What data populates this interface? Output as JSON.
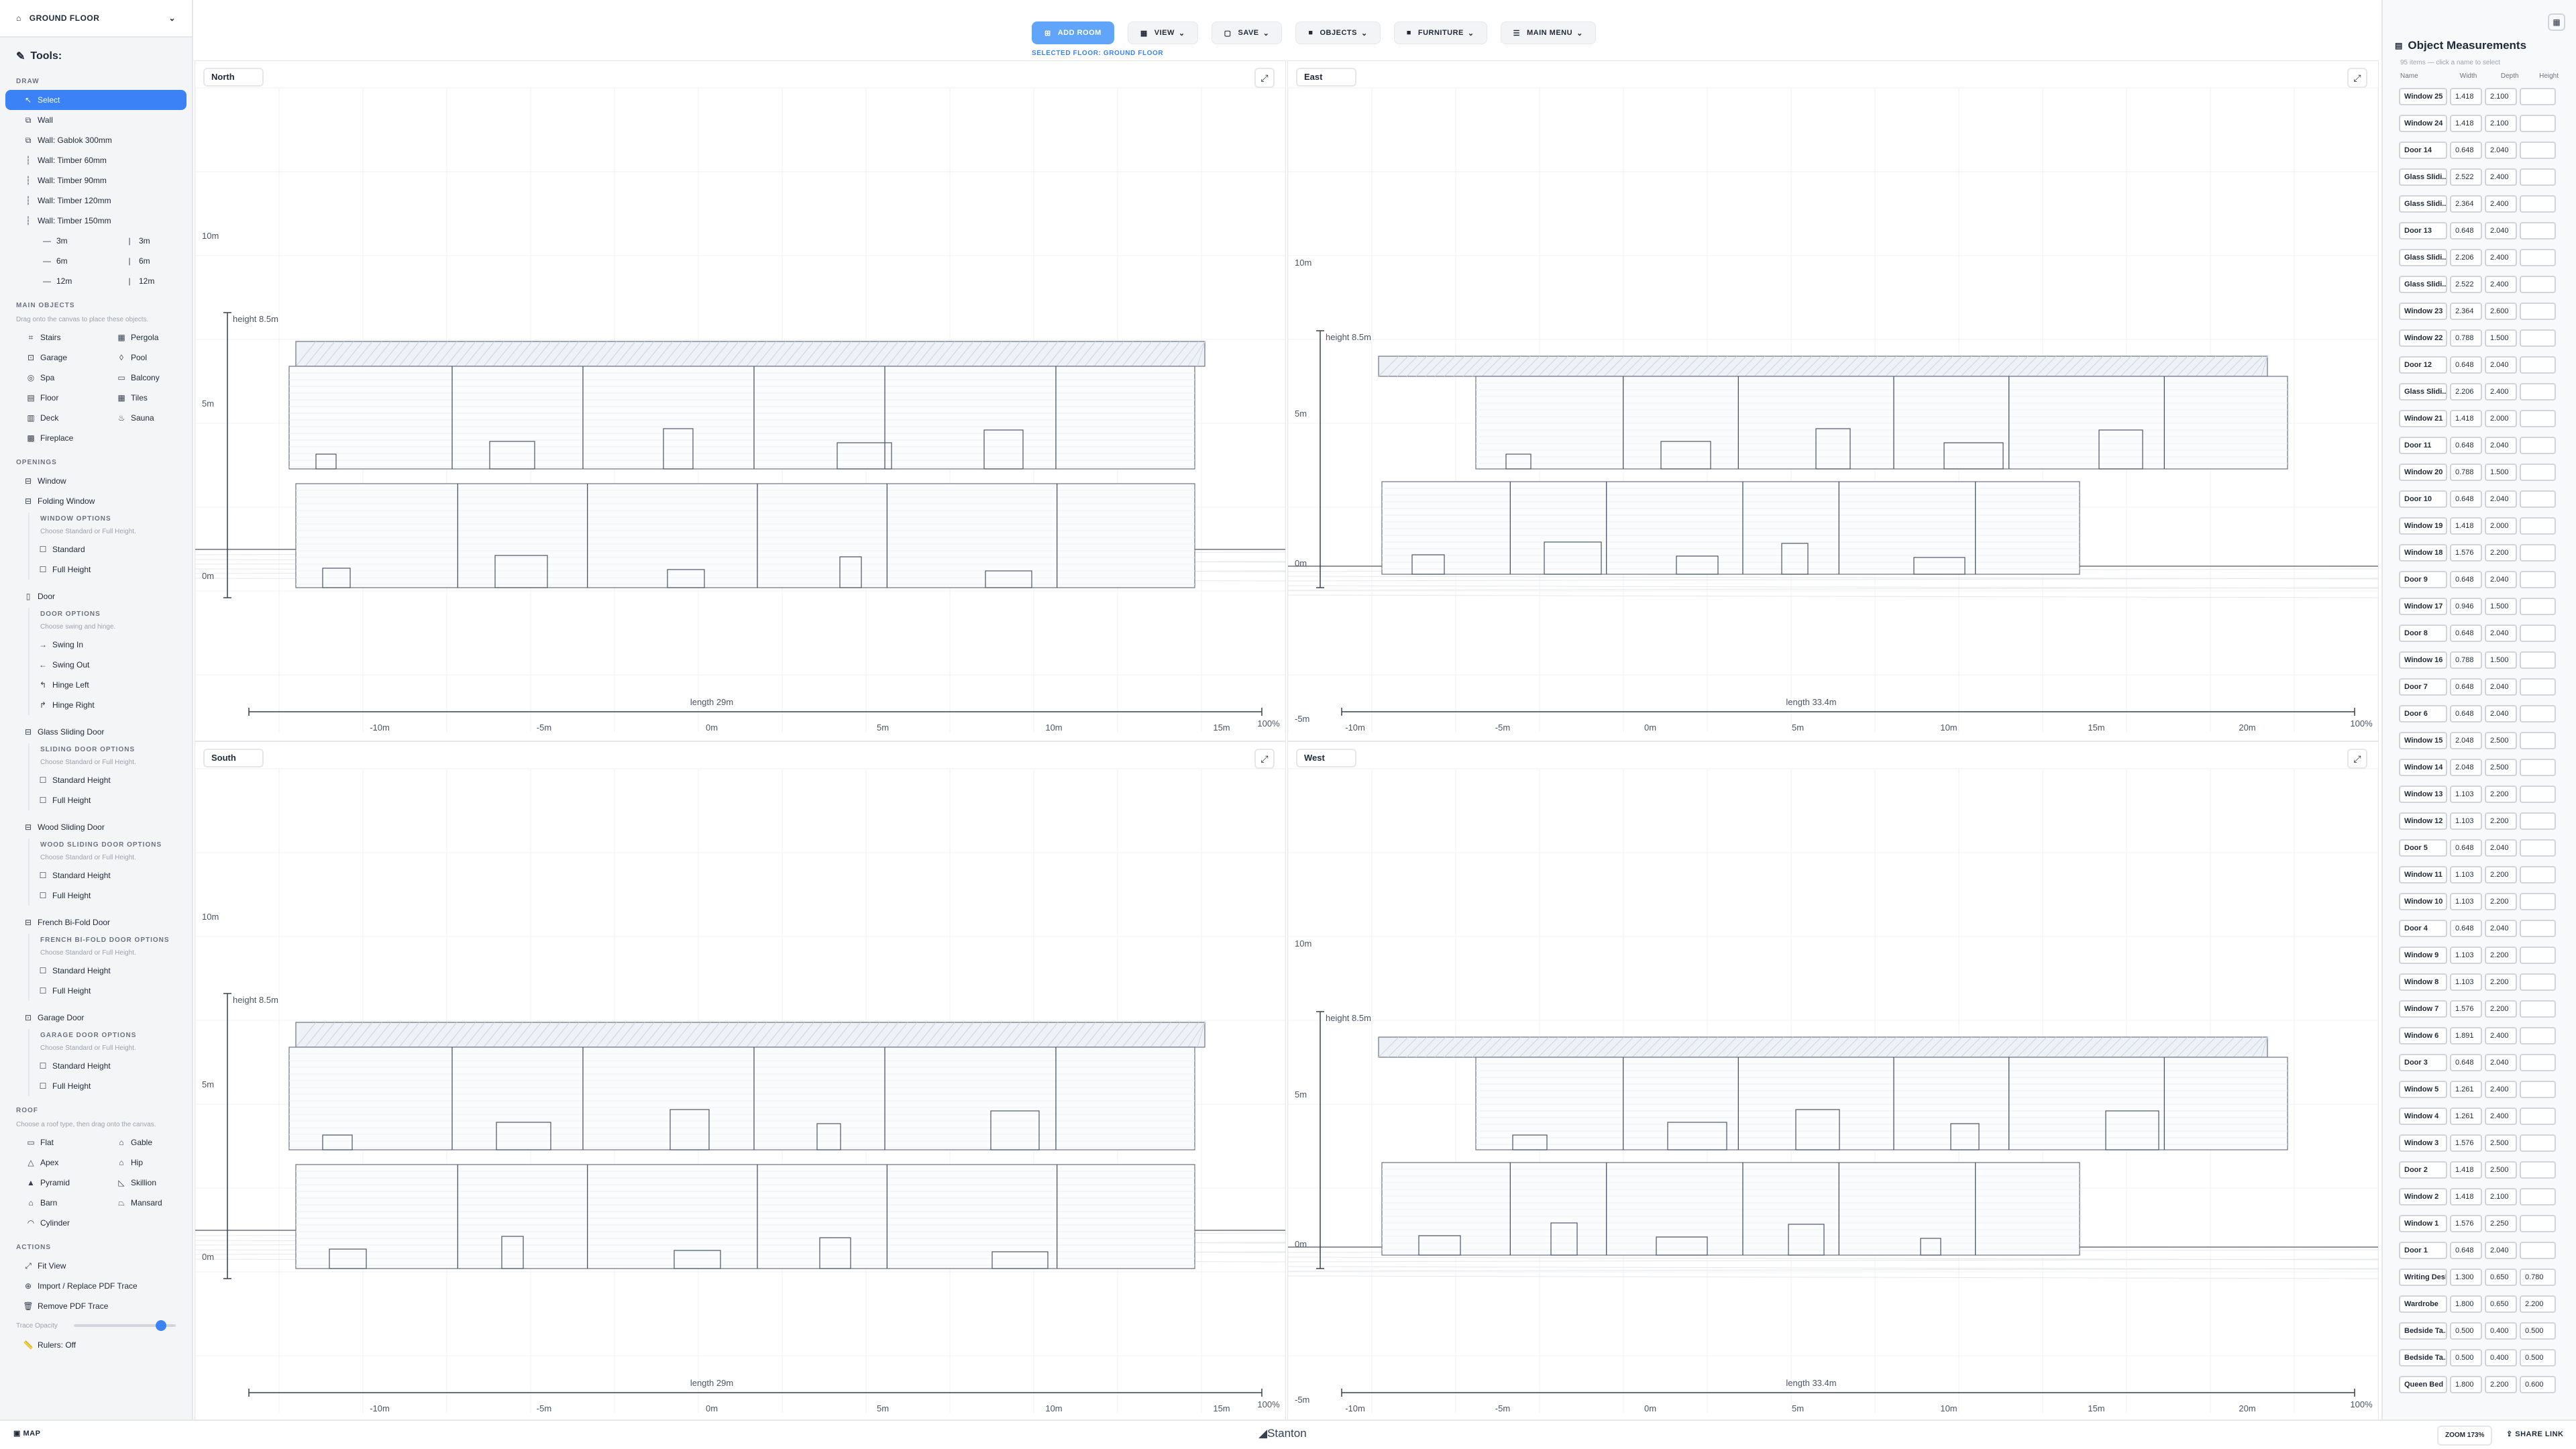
{
  "floor_selector": {
    "label": "GROUND FLOOR"
  },
  "tools": {
    "title": "Tools:"
  },
  "draw": {
    "section": "DRAW",
    "items": [
      "Select",
      "Wall",
      "Wall: Gablok 300mm",
      "Wall: Timber 60mm",
      "Wall: Timber 90mm",
      "Wall: Timber 120mm",
      "Wall: Timber 150mm"
    ],
    "lengths_left": [
      "3m",
      "6m",
      "12m"
    ],
    "lengths_right": [
      "3m",
      "6m",
      "12m"
    ]
  },
  "main_objects": {
    "section": "MAIN OBJECTS",
    "hint": "Drag onto the canvas to place these objects.",
    "left": [
      "Stairs",
      "Garage",
      "Spa",
      "Floor",
      "Deck",
      "Fireplace"
    ],
    "right": [
      "Pergola",
      "Pool",
      "Balcony",
      "Tiles",
      "Sauna"
    ]
  },
  "openings": {
    "section": "OPENINGS",
    "window": "Window",
    "folding_window": "Folding Window",
    "window_options": {
      "title": "WINDOW OPTIONS",
      "hint": "Choose Standard or Full Height.",
      "items": [
        "Standard",
        "Full Height"
      ]
    },
    "door": "Door",
    "door_options": {
      "title": "DOOR OPTIONS",
      "hint": "Choose swing and hinge.",
      "items": [
        "Swing In",
        "Swing Out",
        "Hinge Left",
        "Hinge Right"
      ]
    },
    "glass_sliding": "Glass Sliding Door",
    "glass_options": {
      "title": "SLIDING DOOR OPTIONS",
      "hint": "Choose Standard or Full Height.",
      "items": [
        "Standard Height",
        "Full Height"
      ]
    },
    "wood_sliding": "Wood Sliding Door",
    "wood_options": {
      "title": "WOOD SLIDING DOOR OPTIONS",
      "hint": "Choose Standard or Full Height.",
      "items": [
        "Standard Height",
        "Full Height"
      ]
    },
    "french": "French Bi-Fold Door",
    "french_options": {
      "title": "FRENCH BI-FOLD DOOR OPTIONS",
      "hint": "Choose Standard or Full Height.",
      "items": [
        "Standard Height",
        "Full Height"
      ]
    },
    "garage": "Garage Door",
    "garage_options": {
      "title": "GARAGE DOOR OPTIONS",
      "hint": "Choose Standard or Full Height.",
      "items": [
        "Standard Height",
        "Full Height"
      ]
    }
  },
  "roof": {
    "section": "ROOF",
    "hint": "Choose a roof type, then drag onto the canvas.",
    "left": [
      "Flat",
      "Apex",
      "Pyramid",
      "Barn",
      "Cylinder"
    ],
    "right": [
      "Gable",
      "Hip",
      "Skillion",
      "Mansard"
    ]
  },
  "actions": {
    "section": "ACTIONS",
    "items": [
      "Fit View",
      "Import / Replace PDF Trace",
      "Remove PDF Trace"
    ],
    "trace_opacity": "Trace Opacity",
    "trace_value": 0.85,
    "rulers": "Rulers: Off"
  },
  "toolbar": {
    "add_room": "ADD ROOM",
    "view": "VIEW",
    "save": "SAVE",
    "objects": "OBJECTS",
    "furniture": "FURNITURE",
    "main_menu": "MAIN MENU",
    "selected_floor": "SELECTED FLOOR: GROUND FLOOR"
  },
  "elevations": [
    {
      "title": "North",
      "height_label": "height 8.5m",
      "length_label": "length 29m",
      "zoom": "100%",
      "y_ticks": [
        "10m",
        "5m",
        "0m"
      ],
      "x_ticks": [
        "-10m",
        "-5m",
        "0m",
        "5m",
        "10m",
        "15m"
      ]
    },
    {
      "title": "East",
      "height_label": "height 8.5m",
      "length_label": "length 33.4m",
      "zoom": "100%",
      "y_ticks": [
        "10m",
        "5m",
        "0m",
        "-5m"
      ],
      "x_ticks": [
        "-10m",
        "-5m",
        "0m",
        "5m",
        "10m",
        "15m",
        "20m"
      ]
    },
    {
      "title": "South",
      "height_label": "height 8.5m",
      "length_label": "length 29m",
      "zoom": "100%",
      "y_ticks": [
        "10m",
        "5m",
        "0m"
      ],
      "x_ticks": [
        "-10m",
        "-5m",
        "0m",
        "5m",
        "10m",
        "15m"
      ]
    },
    {
      "title": "West",
      "height_label": "height 8.5m",
      "length_label": "length 33.4m",
      "zoom": "100%",
      "y_ticks": [
        "10m",
        "5m",
        "0m",
        "-5m"
      ],
      "x_ticks": [
        "-10m",
        "-5m",
        "0m",
        "5m",
        "10m",
        "15m",
        "20m"
      ]
    }
  ],
  "measurements": {
    "title": "Object Measurements",
    "subtitle": "95 items — click a name to select",
    "headers": [
      "Name",
      "Width",
      "Depth",
      "Height"
    ],
    "rows": [
      [
        "Window 25",
        "1.418",
        "2.100",
        ""
      ],
      [
        "Window 24",
        "1.418",
        "2.100",
        ""
      ],
      [
        "Door 14",
        "0.648",
        "2.040",
        ""
      ],
      [
        "Glass Slidi...",
        "2.522",
        "2.400",
        ""
      ],
      [
        "Glass Slidi...",
        "2.364",
        "2.400",
        ""
      ],
      [
        "Door 13",
        "0.648",
        "2.040",
        ""
      ],
      [
        "Glass Slidi...",
        "2.206",
        "2.400",
        ""
      ],
      [
        "Glass Slidi...",
        "2.522",
        "2.400",
        ""
      ],
      [
        "Window 23",
        "2.364",
        "2.600",
        ""
      ],
      [
        "Window 22",
        "0.788",
        "1.500",
        ""
      ],
      [
        "Door 12",
        "0.648",
        "2.040",
        ""
      ],
      [
        "Glass Slidi...",
        "2.206",
        "2.400",
        ""
      ],
      [
        "Window 21",
        "1.418",
        "2.000",
        ""
      ],
      [
        "Door 11",
        "0.648",
        "2.040",
        ""
      ],
      [
        "Window 20",
        "0.788",
        "1.500",
        ""
      ],
      [
        "Door 10",
        "0.648",
        "2.040",
        ""
      ],
      [
        "Window 19",
        "1.418",
        "2.000",
        ""
      ],
      [
        "Window 18",
        "1.576",
        "2.200",
        ""
      ],
      [
        "Door 9",
        "0.648",
        "2.040",
        ""
      ],
      [
        "Window 17",
        "0.946",
        "1.500",
        ""
      ],
      [
        "Door 8",
        "0.648",
        "2.040",
        ""
      ],
      [
        "Window 16",
        "0.788",
        "1.500",
        ""
      ],
      [
        "Door 7",
        "0.648",
        "2.040",
        ""
      ],
      [
        "Door 6",
        "0.648",
        "2.040",
        ""
      ],
      [
        "Window 15",
        "2.048",
        "2.500",
        ""
      ],
      [
        "Window 14",
        "2.048",
        "2.500",
        ""
      ],
      [
        "Window 13",
        "1.103",
        "2.200",
        ""
      ],
      [
        "Window 12",
        "1.103",
        "2.200",
        ""
      ],
      [
        "Door 5",
        "0.648",
        "2.040",
        ""
      ],
      [
        "Window 11",
        "1.103",
        "2.200",
        ""
      ],
      [
        "Window 10",
        "1.103",
        "2.200",
        ""
      ],
      [
        "Door 4",
        "0.648",
        "2.040",
        ""
      ],
      [
        "Window 9",
        "1.103",
        "2.200",
        ""
      ],
      [
        "Window 8",
        "1.103",
        "2.200",
        ""
      ],
      [
        "Window 7",
        "1.576",
        "2.200",
        ""
      ],
      [
        "Window 6",
        "1.891",
        "2.400",
        ""
      ],
      [
        "Door 3",
        "0.648",
        "2.040",
        ""
      ],
      [
        "Window 5",
        "1.261",
        "2.400",
        ""
      ],
      [
        "Window 4",
        "1.261",
        "2.400",
        ""
      ],
      [
        "Window 3",
        "1.576",
        "2.500",
        ""
      ],
      [
        "Door 2",
        "1.418",
        "2.500",
        ""
      ],
      [
        "Window 2",
        "1.418",
        "2.100",
        ""
      ],
      [
        "Window 1",
        "1.576",
        "2.250",
        ""
      ],
      [
        "Door 1",
        "0.648",
        "2.040",
        ""
      ],
      [
        "Writing Desk",
        "1.300",
        "0.650",
        "0.780"
      ],
      [
        "Wardrobe",
        "1.800",
        "0.650",
        "2.200"
      ],
      [
        "Bedside Ta...",
        "0.500",
        "0.400",
        "0.500"
      ],
      [
        "Bedside Ta...",
        "0.500",
        "0.400",
        "0.500"
      ],
      [
        "Queen Bed",
        "1.800",
        "2.200",
        "0.600"
      ]
    ]
  },
  "bottom": {
    "map": "MAP",
    "brand": "Stanton",
    "zoom": "ZOOM 173%",
    "share": "SHARE LINK"
  }
}
